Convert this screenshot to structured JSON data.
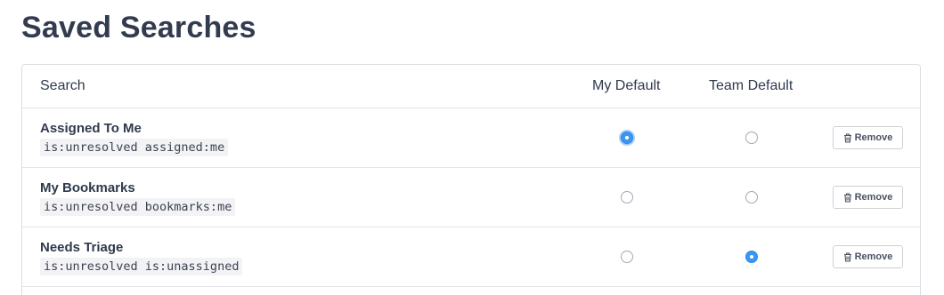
{
  "page": {
    "title": "Saved Searches"
  },
  "table": {
    "headers": {
      "search": "Search",
      "my_default": "My Default",
      "team_default": "Team Default"
    },
    "remove_label": "Remove",
    "rows": [
      {
        "name": "Assigned To Me",
        "query": "is:unresolved assigned:me",
        "my_default": true,
        "team_default": false
      },
      {
        "name": "My Bookmarks",
        "query": "is:unresolved bookmarks:me",
        "my_default": false,
        "team_default": false
      },
      {
        "name": "Needs Triage",
        "query": "is:unresolved is:unassigned",
        "my_default": false,
        "team_default": true
      }
    ]
  },
  "colors": {
    "accent": "#3b97f3",
    "title": "#333b4f",
    "border": "#dcdde3"
  },
  "icons": {
    "remove": "trash-icon"
  }
}
